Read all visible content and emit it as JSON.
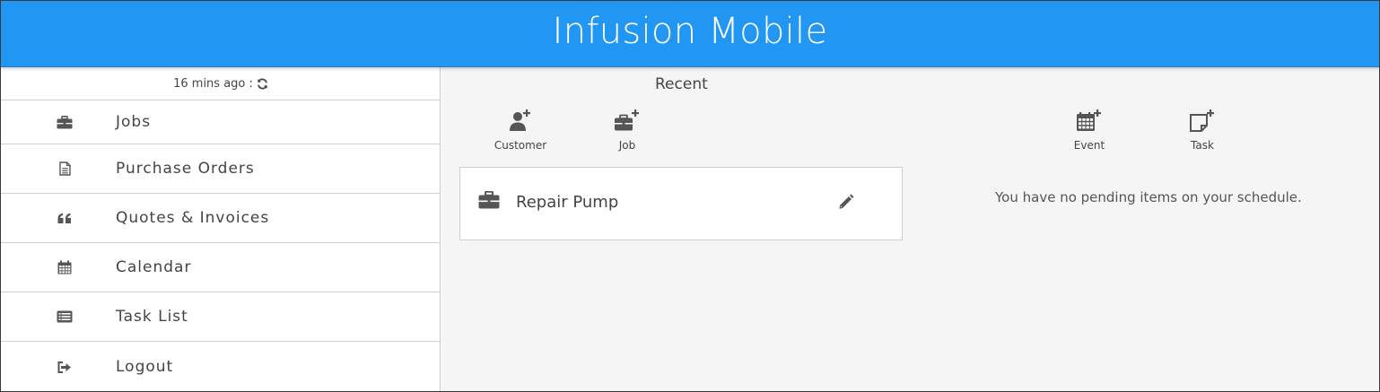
{
  "app": {
    "title": "Infusion Mobile"
  },
  "sidebar": {
    "sync_status": "16 mins ago :",
    "items": [
      {
        "label": "Jobs",
        "icon": "briefcase-icon"
      },
      {
        "label": "Purchase Orders",
        "icon": "file-icon"
      },
      {
        "label": "Quotes & Invoices",
        "icon": "quote-icon"
      },
      {
        "label": "Calendar",
        "icon": "calendar-icon"
      },
      {
        "label": "Task List",
        "icon": "list-icon"
      },
      {
        "label": "Logout",
        "icon": "sign-out-icon"
      }
    ]
  },
  "recent": {
    "title": "Recent",
    "quick_actions": [
      {
        "label": "Customer",
        "icon": "add-user-icon"
      },
      {
        "label": "Job",
        "icon": "add-briefcase-icon"
      }
    ],
    "items": [
      {
        "title": "Repair Pump",
        "icon": "briefcase-icon"
      }
    ]
  },
  "schedule": {
    "quick_actions": [
      {
        "label": "Event",
        "icon": "add-calendar-icon"
      },
      {
        "label": "Task",
        "icon": "add-note-icon"
      }
    ],
    "empty_message": "You have no pending items on your schedule."
  },
  "colors": {
    "header": "#2196F3",
    "main_bg": "#f5f5f5",
    "icon": "#555555"
  }
}
